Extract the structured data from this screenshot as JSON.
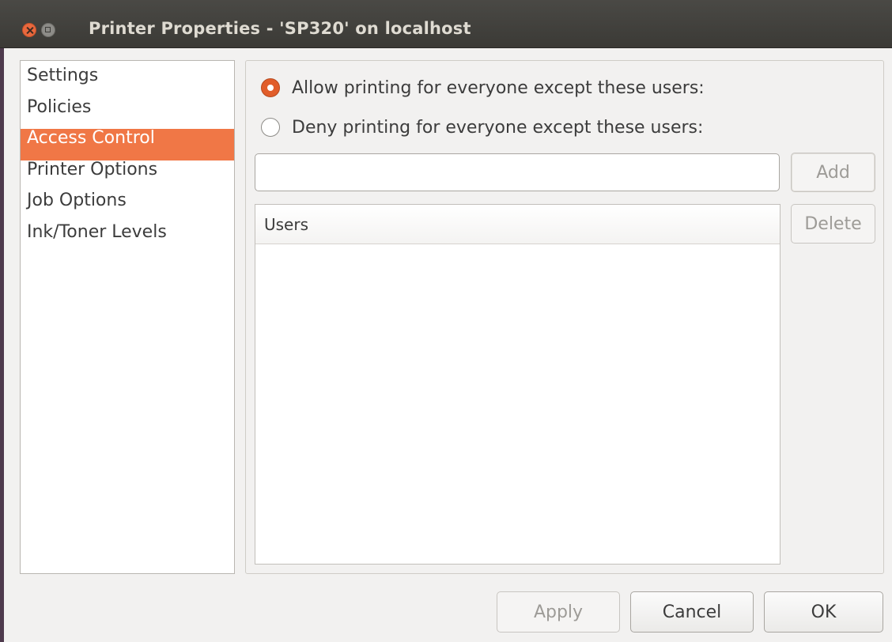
{
  "window": {
    "title": "Printer Properties - 'SP320' on localhost"
  },
  "sidebar": {
    "items": [
      {
        "label": "Settings",
        "selected": false
      },
      {
        "label": "Policies",
        "selected": false
      },
      {
        "label": "Access Control",
        "selected": true
      },
      {
        "label": "Printer Options",
        "selected": false
      },
      {
        "label": "Job Options",
        "selected": false
      },
      {
        "label": "Ink/Toner Levels",
        "selected": false
      }
    ]
  },
  "access": {
    "allow_label": "Allow printing for everyone except these users:",
    "allow_selected": true,
    "deny_label": "Deny printing for everyone except these users:",
    "deny_selected": false,
    "user_input_value": "",
    "user_input_placeholder": "",
    "add_label": "Add",
    "delete_label": "Delete",
    "users_column_header": "Users",
    "users": []
  },
  "footer": {
    "apply_label": "Apply",
    "cancel_label": "Cancel",
    "ok_label": "OK"
  },
  "colors": {
    "accent": "#f07746",
    "radio_on": "#e15d2a",
    "titlebar": "#3b3a36",
    "window_bg": "#f2f1f0"
  }
}
